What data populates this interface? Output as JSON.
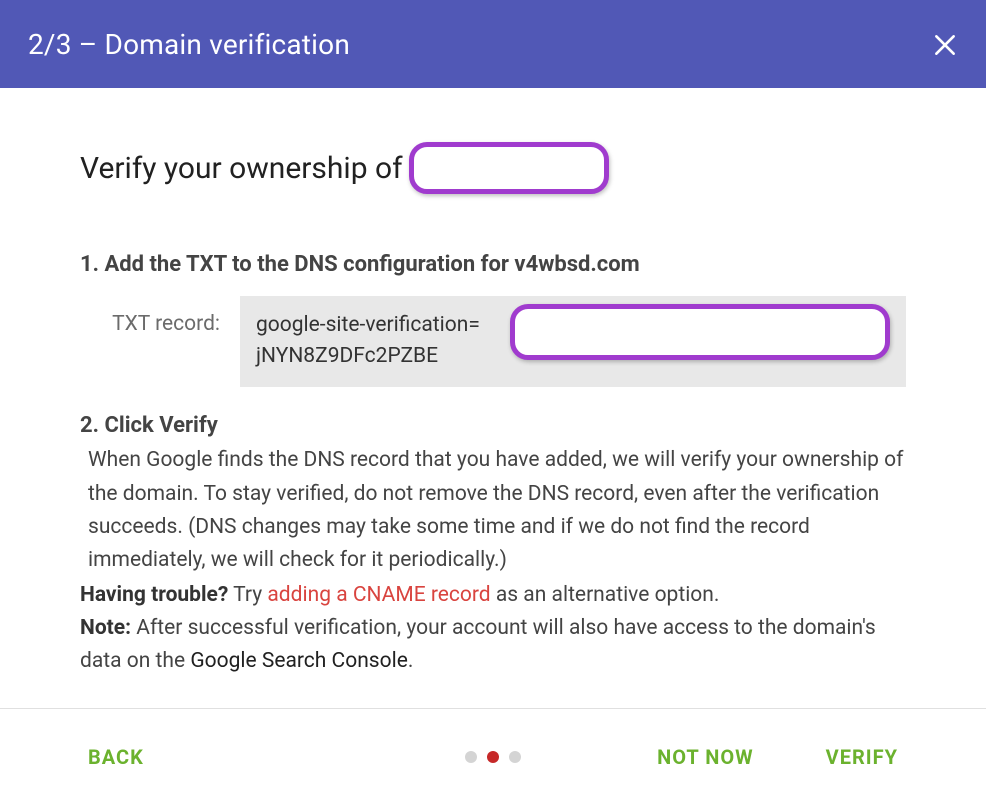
{
  "header": {
    "title": "2/3 – Domain verification"
  },
  "heading": {
    "prefix": "Verify your ownership of "
  },
  "step1": {
    "title": "1. Add the TXT to the DNS configuration for v4wbsd.com",
    "txt_label": "TXT record:",
    "txt_value_line1": "google-site-verification=",
    "txt_value_line2": "jNYN8Z9DFc2PZBE"
  },
  "step2": {
    "title": "2. Click Verify",
    "body": "When Google finds the DNS record that you have added, we will verify your ownership of the domain. To stay verified, do not remove the DNS record, even after the verification succeeds. (DNS changes may take some time and if we do not find the record immediately, we will check for it periodically.)"
  },
  "trouble": {
    "label": "Having trouble?",
    "pre": " Try ",
    "link": "adding a CNAME record",
    "post": " as an alternative option."
  },
  "note": {
    "label": "Note:",
    "pre": " After successful verification, your account will also have access to the domain's data on the ",
    "link": "Google Search Console",
    "post": "."
  },
  "footer": {
    "back": "BACK",
    "not_now": "NOT NOW",
    "verify": "VERIFY"
  },
  "stepper": {
    "total": 3,
    "active": 2
  }
}
